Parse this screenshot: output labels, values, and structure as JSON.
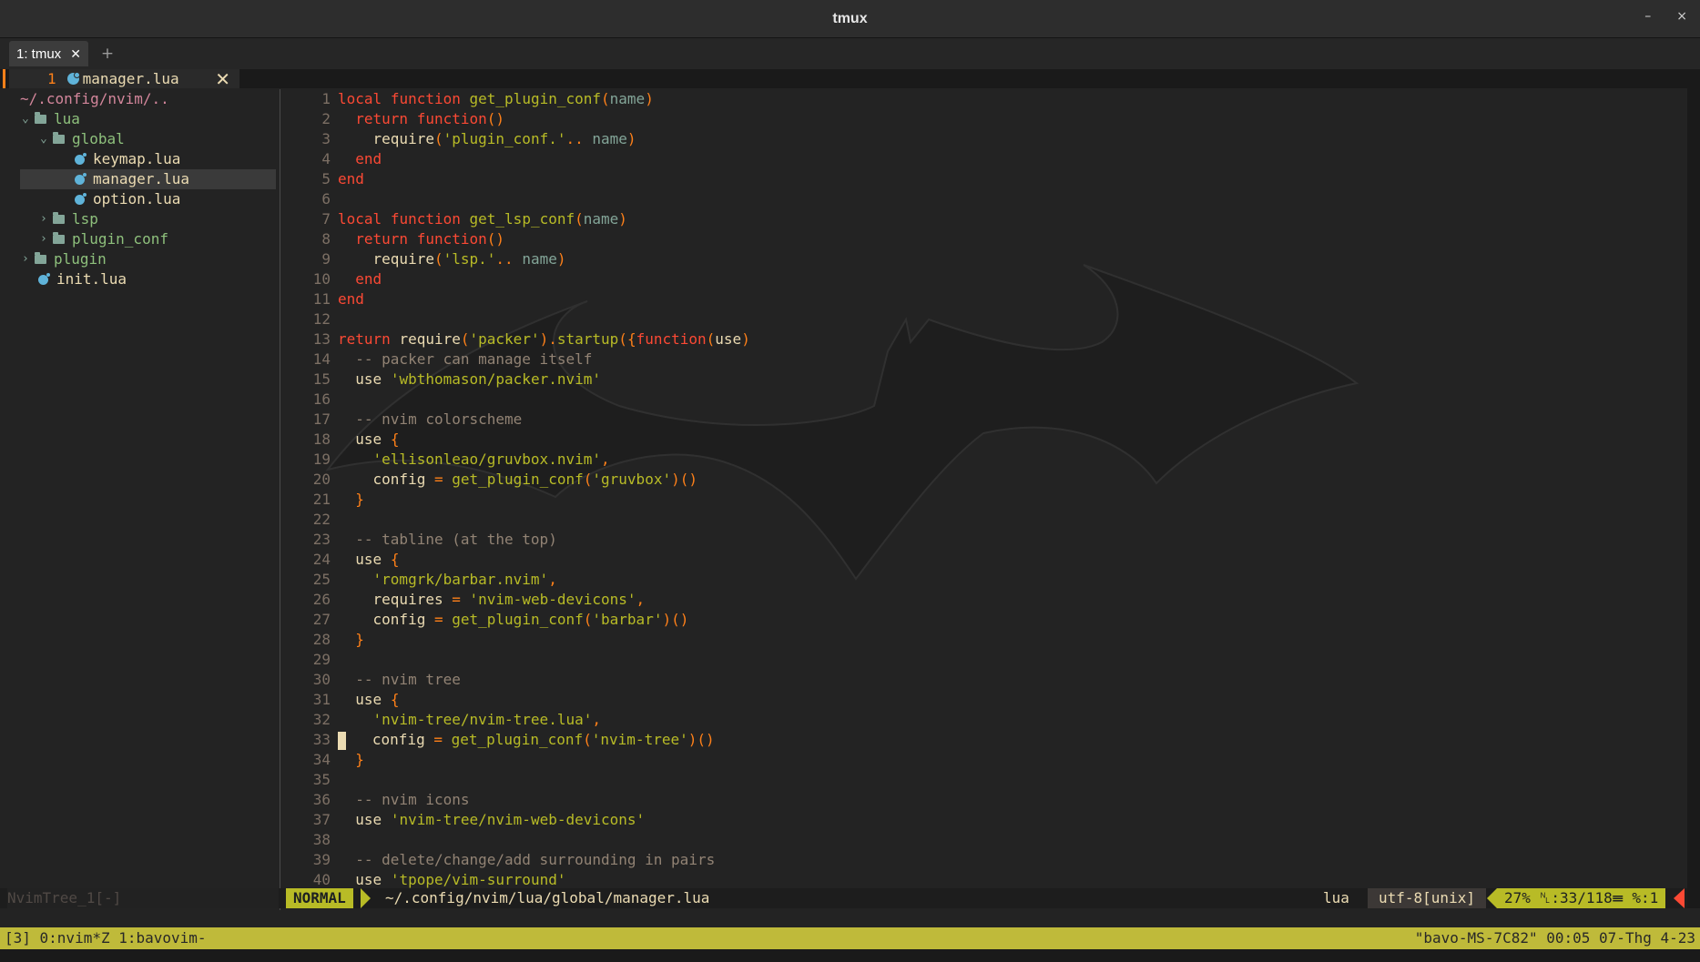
{
  "window": {
    "title": "tmux",
    "minimize_glyph": "–",
    "close_glyph": "×"
  },
  "tabbar": {
    "tab_label": "1: tmux",
    "tab_close_glyph": "✕",
    "new_tab_glyph": "+"
  },
  "buffer": {
    "number": "1",
    "name": "manager.lua",
    "close_glyph": "✕"
  },
  "tree": {
    "root": "~/.config/nvim/..",
    "items": {
      "lua": "lua",
      "global": "global",
      "keymap": "keymap.lua",
      "manager": "manager.lua",
      "option": "option.lua",
      "lsp": "lsp",
      "plugin_conf": "plugin_conf",
      "plugin": "plugin",
      "init": "init.lua"
    }
  },
  "code": {
    "lines": [
      "local function get_plugin_conf(name)",
      "  return function()",
      "    require('plugin_conf.'.. name)",
      "  end",
      "end",
      "",
      "local function get_lsp_conf(name)",
      "  return function()",
      "    require('lsp.'.. name)",
      "  end",
      "end",
      "",
      "return require('packer').startup({function(use)",
      "  -- packer can manage itself",
      "  use 'wbthomason/packer.nvim'",
      "",
      "  -- nvim colorscheme",
      "  use {",
      "    'ellisonleao/gruvbox.nvim',",
      "    config = get_plugin_conf('gruvbox')()",
      "  }",
      "",
      "  -- tabline (at the top)",
      "  use {",
      "    'romgrk/barbar.nvim',",
      "    requires = 'nvim-web-devicons',",
      "    config = get_plugin_conf('barbar')()",
      "  }",
      "",
      "  -- nvim tree",
      "  use {",
      "    'nvim-tree/nvim-tree.lua',",
      "    config = get_plugin_conf('nvim-tree')()",
      "  }",
      "",
      "  -- nvim icons",
      "  use 'nvim-tree/nvim-web-devicons'",
      "",
      "  -- delete/change/add surrounding in pairs",
      "  use 'tpope/vim-surround'"
    ],
    "cursor_line": 33
  },
  "statusline": {
    "tree_label": "NvimTree_1[-]",
    "mode": "NORMAL",
    "file_path": "~/.config/nvim/lua/global/manager.lua",
    "filetype": "lua",
    "encoding": "utf-8[unix]",
    "position": "27% ␤:33/118☰ %:1"
  },
  "tmux": {
    "left": "[3] 0:nvim*Z 1:bavovim-",
    "right": "\"bavo-MS-7C82\" 00:05 07-Thg 4-23"
  },
  "colors": {
    "keyword": "#fb4934",
    "function": "#b8bb26",
    "string": "#b8bb26",
    "comment": "#928374",
    "operator": "#fe8019",
    "identifier": "#83a598",
    "mode_bg": "#b8bb26",
    "tmux_bg": "#bfba3a"
  }
}
